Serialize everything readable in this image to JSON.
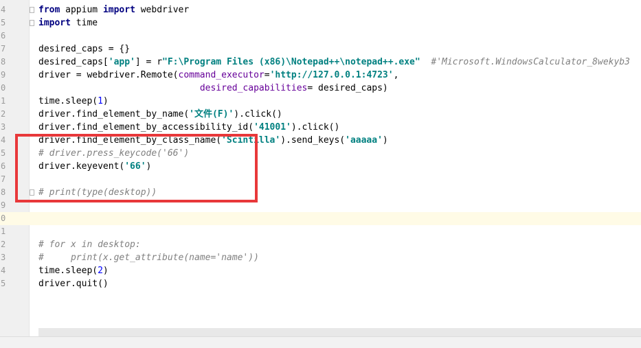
{
  "editor": {
    "lines": [
      {
        "num": "4",
        "code": [
          {
            "t": "from",
            "c": "kw"
          },
          {
            "t": " appium ",
            "c": "plain"
          },
          {
            "t": "import",
            "c": "kw"
          },
          {
            "t": " webdriver",
            "c": "plain"
          }
        ],
        "fold": true
      },
      {
        "num": "5",
        "code": [
          {
            "t": "import",
            "c": "kw"
          },
          {
            "t": " time",
            "c": "plain"
          }
        ],
        "fold": true
      },
      {
        "num": "6",
        "code": []
      },
      {
        "num": "7",
        "code": [
          {
            "t": "desired_caps = {}",
            "c": "plain"
          }
        ]
      },
      {
        "num": "8",
        "code": [
          {
            "t": "desired_caps[",
            "c": "plain"
          },
          {
            "t": "'app'",
            "c": "str"
          },
          {
            "t": "] = r",
            "c": "plain"
          },
          {
            "t": "\"F:\\Program Files (x86)\\Notepad++\\notepad++.exe\"",
            "c": "str"
          },
          {
            "t": "  ",
            "c": "plain"
          },
          {
            "t": "#'Microsoft.WindowsCalculator_8wekyb3",
            "c": "cmt"
          }
        ]
      },
      {
        "num": "9",
        "code": [
          {
            "t": "driver = webdriver.Remote(",
            "c": "plain"
          },
          {
            "t": "command_executor",
            "c": "param"
          },
          {
            "t": "=",
            "c": "plain"
          },
          {
            "t": "'http://127.0.0.1:4723'",
            "c": "str"
          },
          {
            "t": ",",
            "c": "plain"
          }
        ]
      },
      {
        "num": "0",
        "code": [
          {
            "t": "                              ",
            "c": "plain"
          },
          {
            "t": "desired_capabilities",
            "c": "param"
          },
          {
            "t": "= desired_caps)",
            "c": "plain"
          }
        ]
      },
      {
        "num": "1",
        "code": [
          {
            "t": "time.sleep(",
            "c": "plain"
          },
          {
            "t": "1",
            "c": "num"
          },
          {
            "t": ")",
            "c": "plain"
          }
        ]
      },
      {
        "num": "2",
        "code": [
          {
            "t": "driver.find_element_by_name(",
            "c": "plain"
          },
          {
            "t": "'文件(F)'",
            "c": "str"
          },
          {
            "t": ").click()",
            "c": "plain"
          }
        ]
      },
      {
        "num": "3",
        "code": [
          {
            "t": "driver.find_element_by_accessibility_id(",
            "c": "plain"
          },
          {
            "t": "'41001'",
            "c": "str"
          },
          {
            "t": ").click()",
            "c": "plain"
          }
        ]
      },
      {
        "num": "4",
        "code": [
          {
            "t": "driver.find_element_by_class_name(",
            "c": "plain"
          },
          {
            "t": "'Scintilla'",
            "c": "str"
          },
          {
            "t": ").send_keys(",
            "c": "plain"
          },
          {
            "t": "'aaaaa'",
            "c": "str"
          },
          {
            "t": ")",
            "c": "plain"
          }
        ]
      },
      {
        "num": "5",
        "code": [
          {
            "t": "# driver.press_keycode('66')",
            "c": "cmt"
          }
        ]
      },
      {
        "num": "6",
        "code": [
          {
            "t": "driver.keyevent(",
            "c": "plain"
          },
          {
            "t": "'66'",
            "c": "str"
          },
          {
            "t": ")",
            "c": "plain"
          }
        ]
      },
      {
        "num": "7",
        "code": []
      },
      {
        "num": "8",
        "code": [
          {
            "t": "# print(type(desktop))",
            "c": "cmt"
          }
        ],
        "fold": true
      },
      {
        "num": "9",
        "code": []
      },
      {
        "num": "0",
        "code": [],
        "current": true
      },
      {
        "num": "1",
        "code": []
      },
      {
        "num": "2",
        "code": [
          {
            "t": "# for x in desktop:",
            "c": "cmt"
          }
        ]
      },
      {
        "num": "3",
        "code": [
          {
            "t": "#     print(x.get_attribute(name='name'))",
            "c": "cmt"
          }
        ]
      },
      {
        "num": "4",
        "code": [
          {
            "t": "time.sleep(",
            "c": "plain"
          },
          {
            "t": "2",
            "c": "num"
          },
          {
            "t": ")",
            "c": "plain"
          }
        ]
      },
      {
        "num": "5",
        "code": [
          {
            "t": "driver.quit()",
            "c": "plain"
          }
        ]
      }
    ]
  },
  "colors": {
    "keyword": "#000080",
    "string": "#008080",
    "number": "#0000ff",
    "comment": "#808080",
    "param": "#660099",
    "annotation_box": "#e8383a",
    "current_line": "#fffbe6"
  }
}
